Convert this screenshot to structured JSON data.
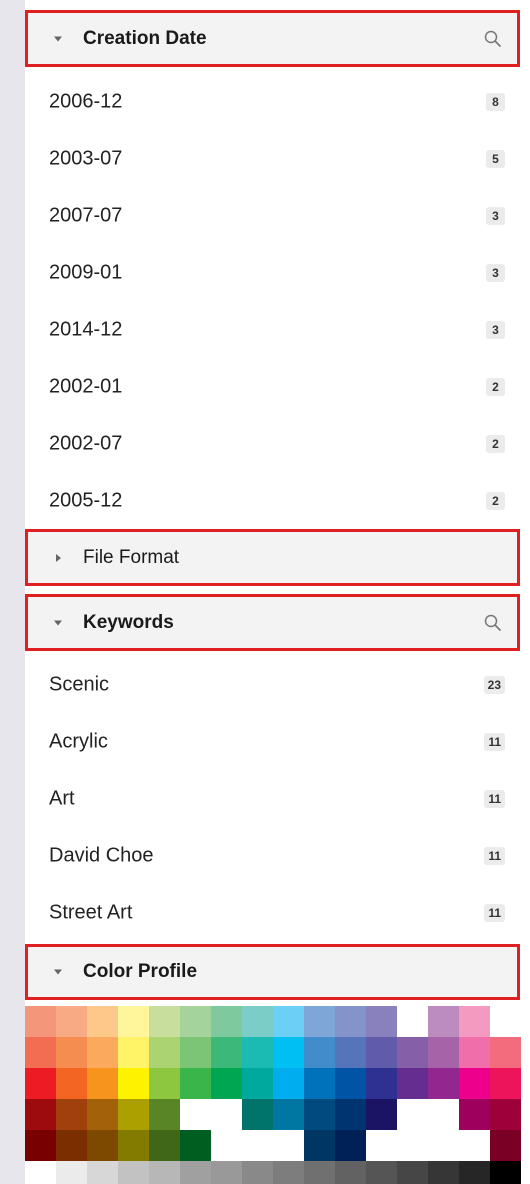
{
  "sections": {
    "creation_date": {
      "title": "Creation Date",
      "items": [
        {
          "label": "2006-12",
          "count": "8"
        },
        {
          "label": "2003-07",
          "count": "5"
        },
        {
          "label": "2007-07",
          "count": "3"
        },
        {
          "label": "2009-01",
          "count": "3"
        },
        {
          "label": "2014-12",
          "count": "3"
        },
        {
          "label": "2002-01",
          "count": "2"
        },
        {
          "label": "2002-07",
          "count": "2"
        },
        {
          "label": "2005-12",
          "count": "2"
        }
      ]
    },
    "file_format": {
      "title": "File Format"
    },
    "keywords": {
      "title": "Keywords",
      "items": [
        {
          "label": "Scenic",
          "count": "23"
        },
        {
          "label": "Acrylic",
          "count": "11"
        },
        {
          "label": "Art",
          "count": "11"
        },
        {
          "label": "David Choe",
          "count": "11"
        },
        {
          "label": "Street Art",
          "count": "11"
        }
      ]
    },
    "color_profile": {
      "title": "Color Profile",
      "palette": [
        [
          "#f4967a",
          "#f7aa84",
          "#fcc98a",
          "#fff59a",
          "#c7de9d",
          "#a4d39c",
          "#7fc99f",
          "#7bcdc8",
          "#6ccff6",
          "#7ea7d8",
          "#8493ca",
          "#8881be",
          "#ffffff",
          "#bd8cbf",
          "#f49ac1",
          "#ffffff"
        ],
        [
          "#f26d51",
          "#f58c50",
          "#fbaa5d",
          "#fff467",
          "#acd372",
          "#7cc576",
          "#3cb878",
          "#1bbbb4",
          "#00bff3",
          "#438ccb",
          "#5674b9",
          "#605ca9",
          "#8560a8",
          "#a763a8",
          "#f06ea9",
          "#f26c7d"
        ],
        [
          "#ed1c24",
          "#f26522",
          "#f7941d",
          "#fff200",
          "#8dc63f",
          "#39b54a",
          "#00a651",
          "#00a99d",
          "#00aeef",
          "#0072bc",
          "#0054a6",
          "#2e3192",
          "#662d91",
          "#92278f",
          "#ec008c",
          "#ed145b"
        ],
        [
          "#9e0b0f",
          "#a0410d",
          "#a3620a",
          "#aba000",
          "#598527",
          "#ffffff",
          "#ffffff",
          "#00746b",
          "#0076a3",
          "#004a80",
          "#003471",
          "#1b1464",
          "#ffffff",
          "#ffffff",
          "#9e005d",
          "#9e0039"
        ],
        [
          "#790000",
          "#7b2e00",
          "#7d4900",
          "#827b00",
          "#406618",
          "#005e20",
          "#ffffff",
          "#ffffff",
          "#ffffff",
          "#003663",
          "#002157",
          "#ffffff",
          "#ffffff",
          "#ffffff",
          "#ffffff",
          "#7a0026"
        ],
        [
          "#ffffff",
          "#ebebeb",
          "#d7d7d7",
          "#c2c2c2",
          "#b7b7b7",
          "#a0a0a0",
          "#999999",
          "#898989",
          "#7d7d7d",
          "#707070",
          "#626262",
          "#555555",
          "#464646",
          "#363636",
          "#262626",
          "#000000"
        ]
      ]
    }
  }
}
